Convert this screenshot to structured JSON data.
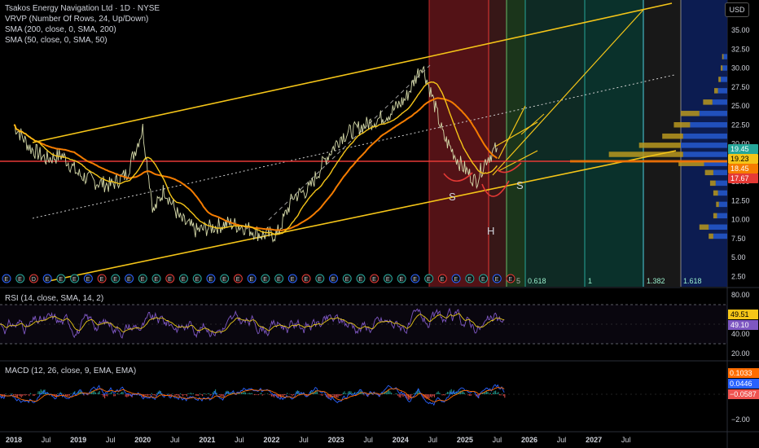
{
  "header": {
    "symbol_line": "Tsakos Energy Navigation Ltd · 1D · NYSE",
    "indicators": [
      "VRVP (Number Of Rows, 24, Up/Down)",
      "SMA (200, close, 0, SMA, 200)",
      "SMA (50, close, 0, SMA, 50)"
    ],
    "currency": "USD"
  },
  "colors": {
    "background": "#000000",
    "price": "#d4d8a8",
    "sma200": "#f57c00",
    "sma50": "#f5c518",
    "channel": "#f5c518",
    "horizontal": "#e53935",
    "vp_up": "#2457c8",
    "vp_down": "#b8981f",
    "rsi": "#7e57c2",
    "rsi_ma": "#e6c619",
    "macd": "#2962ff",
    "signal": "#ff6d00",
    "hist_pos": "#26a69a",
    "hist_neg": "#ef5350"
  },
  "chart_data": [
    {
      "type": "line",
      "panel": "price",
      "y_ticks": [
        "35.00",
        "32.50",
        "30.00",
        "27.50",
        "25.00",
        "22.50",
        "20.00",
        "17.50",
        "15.00",
        "12.50",
        "10.00",
        "7.50",
        "5.00",
        "2.50"
      ],
      "ylim": [
        2.5,
        37.5
      ],
      "x_ticks": [
        "2018",
        "Jul",
        "2019",
        "Jul",
        "2020",
        "Jul",
        "2021",
        "Jul",
        "2022",
        "Jul",
        "2023",
        "Jul",
        "2024",
        "Jul",
        "2025",
        "Jul",
        "2026",
        "Jul",
        "2027",
        "Jul"
      ],
      "price_tags": [
        {
          "value": 19.45,
          "label": "19.45",
          "color": "#26a69a"
        },
        {
          "value": 19.23,
          "label": "19.23",
          "color": "#f5c518"
        },
        {
          "value": 18.45,
          "label": "18.45",
          "color": "#f57c00"
        },
        {
          "value": 17.67,
          "label": "17.67",
          "color": "#e53935"
        }
      ],
      "close_series": [
        [
          "2018-01",
          22.5
        ],
        [
          "2018-04",
          19.5
        ],
        [
          "2018-07",
          18.0
        ],
        [
          "2018-10",
          18.5
        ],
        [
          "2019-01",
          16.0
        ],
        [
          "2019-04",
          15.0
        ],
        [
          "2019-07",
          14.5
        ],
        [
          "2019-10",
          16.0
        ],
        [
          "2020-01",
          22.0
        ],
        [
          "2020-03",
          11.0
        ],
        [
          "2020-05",
          14.0
        ],
        [
          "2020-08",
          10.0
        ],
        [
          "2020-11",
          8.5
        ],
        [
          "2021-02",
          9.0
        ],
        [
          "2021-05",
          9.5
        ],
        [
          "2021-08",
          9.0
        ],
        [
          "2021-11",
          8.0
        ],
        [
          "2022-02",
          8.0
        ],
        [
          "2022-05",
          13.0
        ],
        [
          "2022-08",
          14.0
        ],
        [
          "2022-11",
          18.0
        ],
        [
          "2023-02",
          21.0
        ],
        [
          "2023-05",
          22.0
        ],
        [
          "2023-08",
          23.0
        ],
        [
          "2023-11",
          24.0
        ],
        [
          "2024-02",
          26.0
        ],
        [
          "2024-05",
          30.5
        ],
        [
          "2024-07",
          26.0
        ],
        [
          "2024-09",
          21.0
        ],
        [
          "2024-12",
          17.5
        ],
        [
          "2025-03",
          15.0
        ],
        [
          "2025-05",
          18.0
        ],
        [
          "2025-07",
          19.45
        ]
      ],
      "annotations": [
        "S",
        "H",
        "S"
      ],
      "fib_labels": [
        "0.618",
        "1",
        "1.382",
        "1.618"
      ],
      "fib_prefix": "5"
    },
    {
      "type": "line",
      "panel": "rsi",
      "title": "RSI (14, close, SMA, 14, 2)",
      "y_ticks": [
        "80.00",
        "60.00",
        "40.00",
        "20.00"
      ],
      "ylim": [
        20,
        80
      ],
      "bands": [
        70,
        30
      ],
      "values": [
        49.51,
        49.1
      ]
    },
    {
      "type": "line",
      "panel": "macd",
      "title": "MACD (12, 26, close, 9, EMA, EMA)",
      "y_ticks": [
        "0.00",
        "−2.00"
      ],
      "values": [
        0.1033,
        0.0446,
        -0.0587
      ],
      "value_labels": [
        "0.1033",
        "0.0446",
        "−0.0587"
      ]
    }
  ],
  "earnings_markers": [
    "E",
    "E",
    "D",
    "E",
    "E",
    "E",
    "E",
    "E",
    "E",
    "E",
    "E",
    "E",
    "E",
    "E",
    "E",
    "E",
    "E",
    "E",
    "E",
    "E",
    "E",
    "E",
    "E",
    "E",
    "E",
    "E",
    "E",
    "E",
    "E",
    "E",
    "E",
    "E",
    "E",
    "E",
    "E",
    "E",
    "E",
    "E"
  ]
}
